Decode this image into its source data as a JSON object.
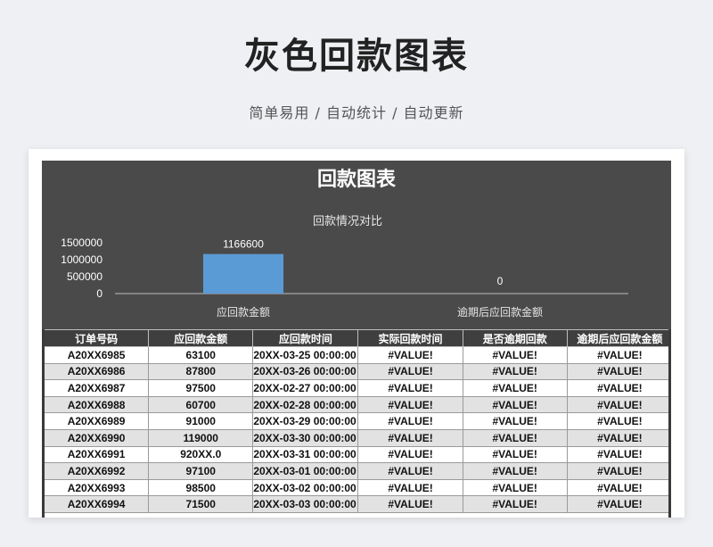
{
  "header": {
    "title": "灰色回款图表",
    "subtitle": "简单易用 / 自动统计 / 自动更新"
  },
  "colors": {
    "background": "#eef0f3",
    "panel": "#4a4a4a",
    "bar": "#5b9bd5",
    "table_header": "#3f3f3f",
    "row_alt": "#e2e2e2"
  },
  "sheet": {
    "title": "回款图表"
  },
  "chart_data": {
    "type": "bar",
    "title": "回款情况对比",
    "categories": [
      "应回款金额",
      "逾期后应回款金额"
    ],
    "values": [
      1166600,
      0
    ],
    "data_labels": [
      "1166600",
      "0"
    ],
    "ylim": [
      0,
      1500000
    ],
    "yticks": [
      1500000,
      1000000,
      500000,
      0
    ],
    "ytick_labels": [
      "1500000",
      "1000000",
      "500000",
      "0"
    ],
    "grid": false,
    "legend": "none"
  },
  "table": {
    "headers": [
      "订单号码",
      "应回款金额",
      "应回款时间",
      "实际回款时间",
      "是否逾期回款",
      "逾期后应回款金额"
    ],
    "rows": [
      [
        "A20XX6985",
        "63100",
        "20XX-03-25 00:00:00",
        "#VALUE!",
        "#VALUE!",
        "#VALUE!"
      ],
      [
        "A20XX6986",
        "87800",
        "20XX-03-26 00:00:00",
        "#VALUE!",
        "#VALUE!",
        "#VALUE!"
      ],
      [
        "A20XX6987",
        "97500",
        "20XX-02-27 00:00:00",
        "#VALUE!",
        "#VALUE!",
        "#VALUE!"
      ],
      [
        "A20XX6988",
        "60700",
        "20XX-02-28 00:00:00",
        "#VALUE!",
        "#VALUE!",
        "#VALUE!"
      ],
      [
        "A20XX6989",
        "91000",
        "20XX-03-29 00:00:00",
        "#VALUE!",
        "#VALUE!",
        "#VALUE!"
      ],
      [
        "A20XX6990",
        "119000",
        "20XX-03-30 00:00:00",
        "#VALUE!",
        "#VALUE!",
        "#VALUE!"
      ],
      [
        "A20XX6991",
        "920XX.0",
        "20XX-03-31 00:00:00",
        "#VALUE!",
        "#VALUE!",
        "#VALUE!"
      ],
      [
        "A20XX6992",
        "97100",
        "20XX-03-01 00:00:00",
        "#VALUE!",
        "#VALUE!",
        "#VALUE!"
      ],
      [
        "A20XX6993",
        "98500",
        "20XX-03-02 00:00:00",
        "#VALUE!",
        "#VALUE!",
        "#VALUE!"
      ],
      [
        "A20XX6994",
        "71500",
        "20XX-03-03 00:00:00",
        "#VALUE!",
        "#VALUE!",
        "#VALUE!"
      ]
    ]
  }
}
